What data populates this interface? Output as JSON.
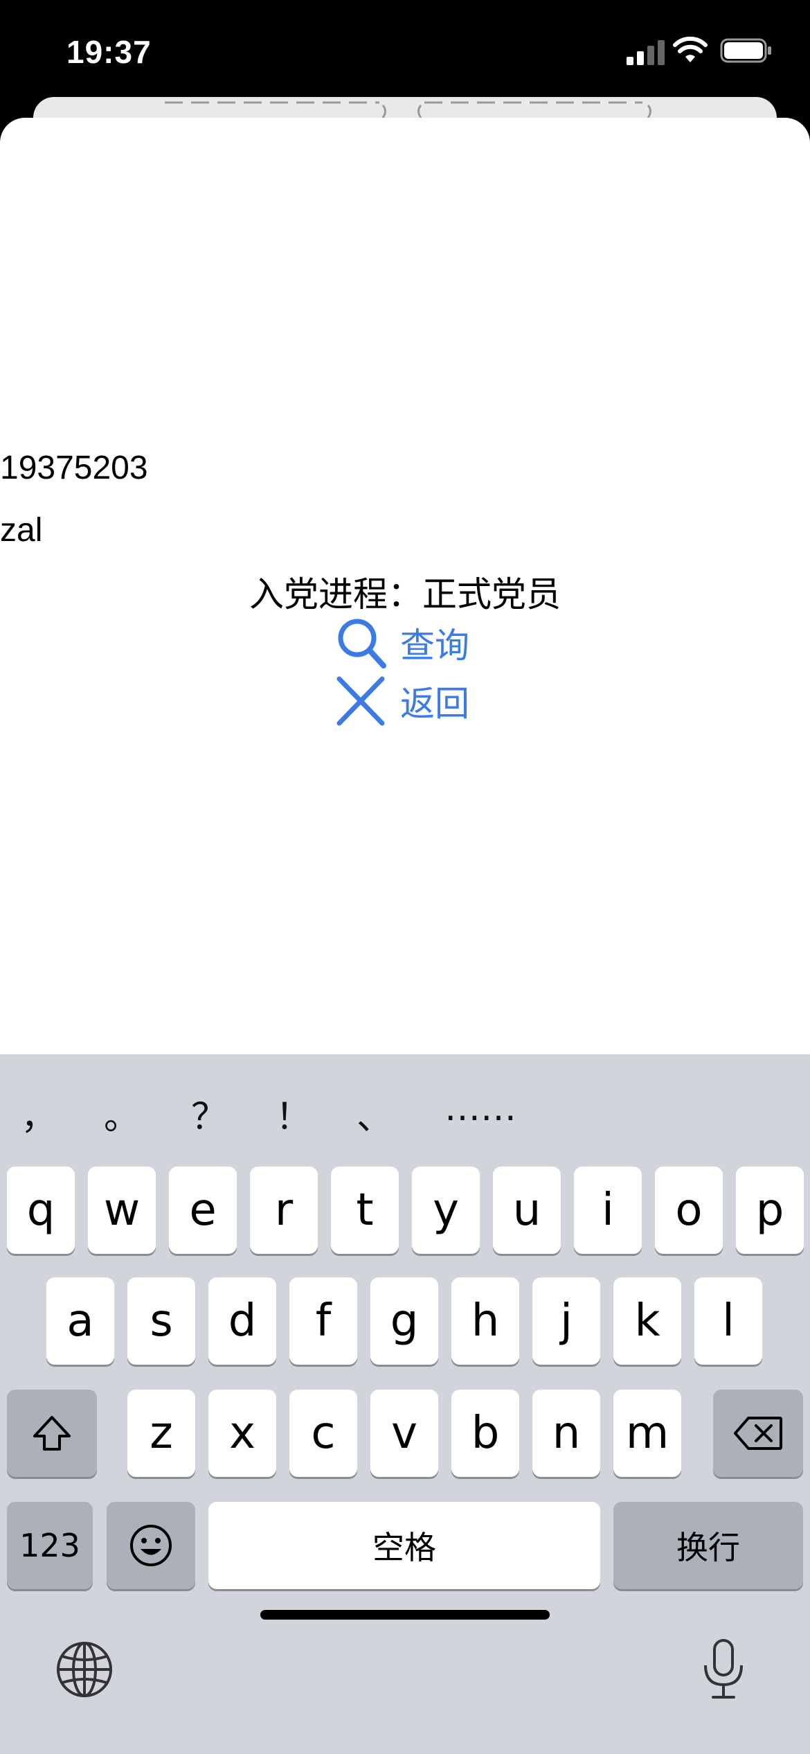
{
  "status": {
    "time": "19:37"
  },
  "form": {
    "id_value": "19375203",
    "name_value": "zal",
    "progress_label": "入党进程：",
    "progress_value": "正式党员",
    "query_label": "查询",
    "back_label": "返回"
  },
  "keyboard": {
    "candidates": [
      "，",
      "。",
      "？",
      "！",
      "、",
      "……"
    ],
    "row1": [
      "q",
      "w",
      "e",
      "r",
      "t",
      "y",
      "u",
      "i",
      "o",
      "p"
    ],
    "row2": [
      "a",
      "s",
      "d",
      "f",
      "g",
      "h",
      "j",
      "k",
      "l"
    ],
    "row3": [
      "z",
      "x",
      "c",
      "v",
      "b",
      "n",
      "m"
    ],
    "numbers_label": "123",
    "space_label": "空格",
    "return_label": "换行"
  },
  "colors": {
    "accent": "#3a7be8",
    "keyboard_bg": "#d1d4da",
    "dark_key": "#acb0b8"
  },
  "icons": [
    "search-icon",
    "close-icon",
    "shift-icon",
    "backspace-icon",
    "emoji-icon",
    "globe-icon",
    "microphone-icon"
  ]
}
